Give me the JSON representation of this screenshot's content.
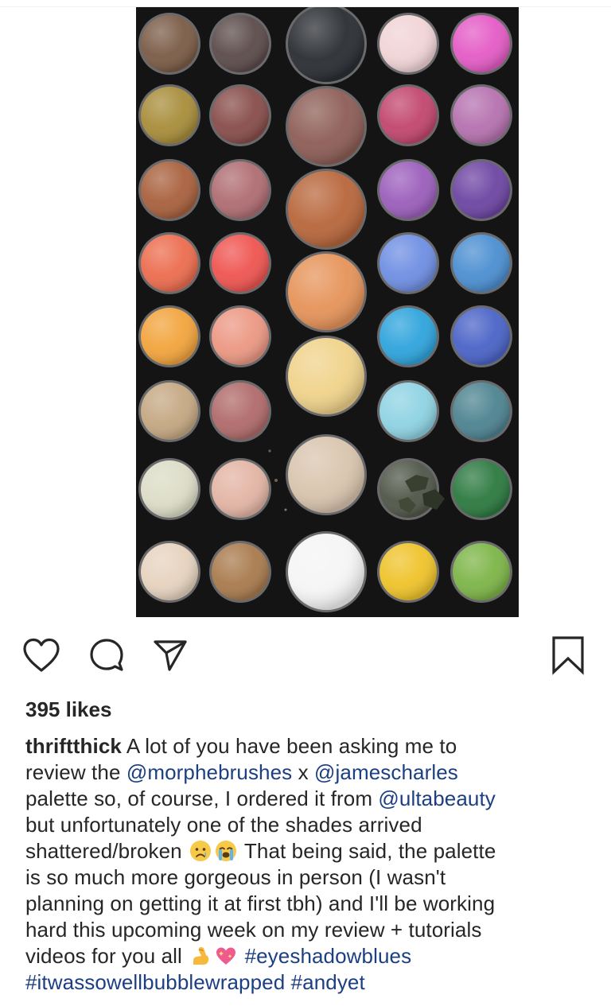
{
  "post": {
    "image": {
      "subject": "eyeshadow-palette-photo"
    },
    "actions": {
      "like_icon": "heart-outline-icon",
      "comment_icon": "comment-bubble-icon",
      "share_icon": "paper-plane-icon",
      "save_icon": "bookmark-outline-icon"
    },
    "likes_text": "395 likes",
    "caption": {
      "username": "thriftthick",
      "l1_text": " A lot of you have been asking me to",
      "l2_text_a": "review the ",
      "l2_mention_1": "@morphebrushes",
      "l2_text_b": " x ",
      "l2_mention_2": "@jamescharles",
      "l3_text": "palette so, of course, I ordered it from ",
      "l3_mention": "@ultabeauty",
      "l4_text": "but unfortunately one of the shades arrived",
      "l5_text_a": "shattered/broken ",
      "l5_emoji_1": "crying-face-emoji",
      "l5_emoji_2": "loudly-crying-face-emoji",
      "l5_text_b": " That being said, the palette",
      "l6_text": "is so much more gorgeous in person (I wasn't",
      "l7_text": "planning on getting it at first tbh) and I'll be working",
      "l8_text": "hard this upcoming week on my review + tutorials",
      "l9_text": "videos for you all ",
      "l9_emoji_1": "flexed-biceps-emoji",
      "l9_emoji_2": "sparkling-heart-emoji",
      "l9_hashtag": "#eyeshadowblues",
      "l10_hashtag_1": "#itwassowellbubblewrapped",
      "l10_hashtag_2": "#andyet"
    },
    "colors": {
      "text": "#262626",
      "link": "#1c3f82",
      "palette_bg": "#141415"
    }
  }
}
